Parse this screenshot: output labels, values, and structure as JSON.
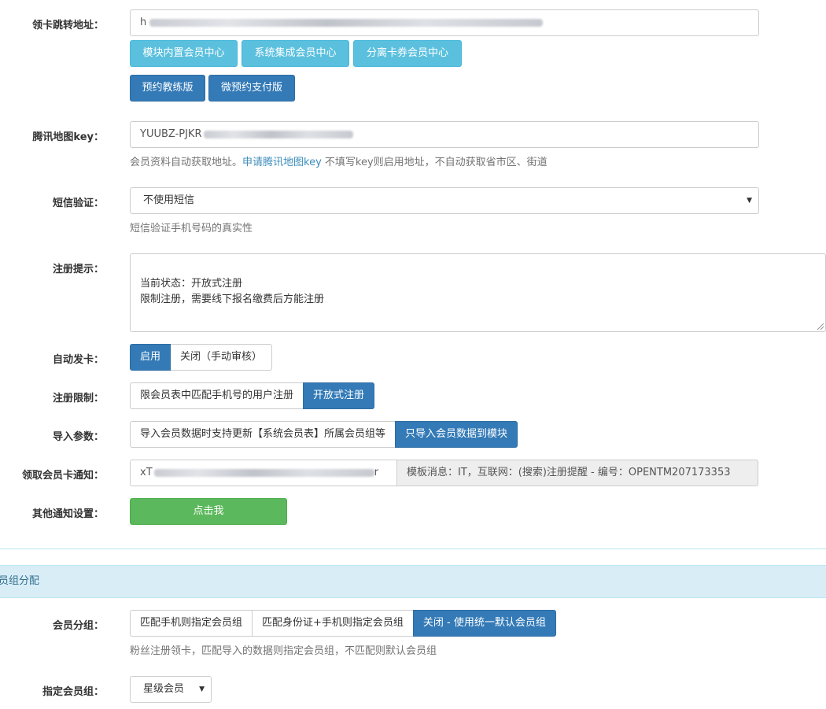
{
  "fields": {
    "redirect_url": {
      "label": "领卡跳转地址：",
      "value_prefix": "h",
      "buttons_row1": [
        "模块内置会员中心",
        "系统集成会员中心",
        "分离卡券会员中心"
      ],
      "buttons_row2": [
        "预约教练版",
        "微预约支付版"
      ]
    },
    "map_key": {
      "label": "腾讯地图key：",
      "value_prefix": "YUUBZ-PJKR",
      "help_before": "会员资料自动获取地址。",
      "help_link": "申请腾讯地图key",
      "help_after": " 不填写key则启用地址，不自动获取省市区、街道"
    },
    "sms": {
      "label": "短信验证：",
      "selected": "不使用短信",
      "help": "短信验证手机号码的真实性"
    },
    "register_tip": {
      "label": "注册提示：",
      "value": "当前状态：开放式注册\n限制注册，需要线下报名缴费后方能注册"
    },
    "auto_card": {
      "label": "自动发卡：",
      "options": [
        "启用",
        "关闭（手动审核）"
      ],
      "active": 0
    },
    "register_limit": {
      "label": "注册限制：",
      "options": [
        "限会员表中匹配手机号的用户注册",
        "开放式注册"
      ],
      "active": 1
    },
    "import_param": {
      "label": "导入参数：",
      "options": [
        "导入会员数据时支持更新【系统会员表】所属会员组等",
        "只导入会员数据到模块"
      ],
      "active": 1
    },
    "card_notice": {
      "label": "领取会员卡通知：",
      "value_prefix": "xT",
      "value_suffix": "r",
      "addon": "模板消息：IT，互联网：(搜索)注册提醒 - 编号：OPENTM207173353"
    },
    "other_notice": {
      "label": "其他通知设置：",
      "button": "点击我"
    }
  },
  "section": {
    "title": "员组分配"
  },
  "member_group": {
    "label": "会员分组：",
    "options": [
      "匹配手机则指定会员组",
      "匹配身份证+手机则指定会员组",
      "关闭 - 使用统一默认会员组"
    ],
    "active": 2,
    "help": "粉丝注册领卡，匹配导入的数据则指定会员组，不匹配则默认会员组"
  },
  "assign_group": {
    "label": "指定会员组：",
    "selected": "星级会员"
  },
  "colors": {
    "primary": "#337ab7",
    "info": "#5bc0de",
    "success": "#5cb85c",
    "panel_heading_bg": "#d9edf7",
    "link": "#3c8dbc"
  },
  "icons": {
    "select_caret": "caret-down-icon",
    "textarea_resize": "resize-handle-icon"
  }
}
